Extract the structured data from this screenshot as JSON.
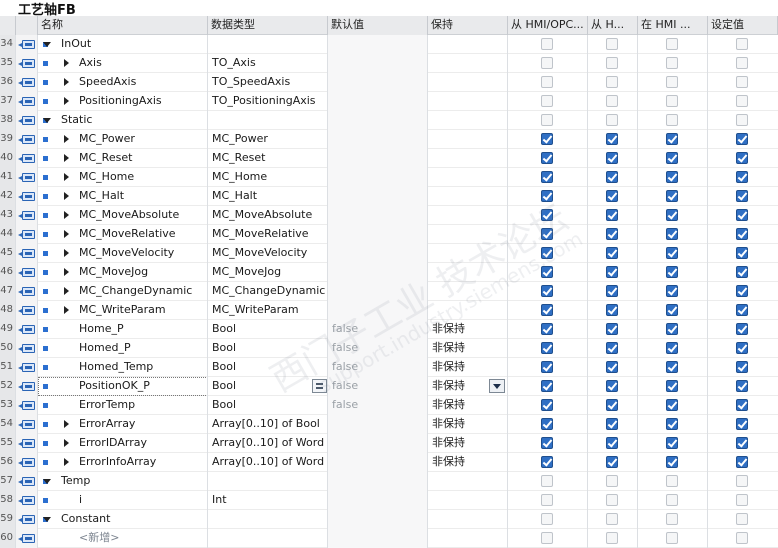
{
  "title": "工艺轴FB",
  "headers": {
    "name": "名称",
    "type": "数据类型",
    "default": "默认值",
    "retain": "保持",
    "hmi_opc": "从 HMI/OPC...",
    "hmi_h": "从 H...",
    "hmi_in": "在 HMI ...",
    "setpoint": "设定值"
  },
  "watermark": "西门子工业 技术论坛",
  "watermark_url": "support.industry.siemens.com",
  "rows": [
    {
      "num": "34",
      "kind": "section",
      "expand": "open",
      "name": "InOut",
      "type": "",
      "def": "",
      "ret": "",
      "c": [
        0,
        0,
        0,
        0
      ]
    },
    {
      "num": "35",
      "kind": "member",
      "expand": "closed",
      "name": "Axis",
      "type": "TO_Axis",
      "def": "",
      "ret": "",
      "c": [
        0,
        0,
        0,
        0
      ]
    },
    {
      "num": "36",
      "kind": "member",
      "expand": "closed",
      "name": "SpeedAxis",
      "type": "TO_SpeedAxis",
      "def": "",
      "ret": "",
      "c": [
        0,
        0,
        0,
        0
      ]
    },
    {
      "num": "37",
      "kind": "member",
      "expand": "closed",
      "name": "PositioningAxis",
      "type": "TO_PositioningAxis",
      "def": "",
      "ret": "",
      "c": [
        0,
        0,
        0,
        0
      ]
    },
    {
      "num": "38",
      "kind": "section",
      "expand": "open",
      "name": "Static",
      "type": "",
      "def": "",
      "ret": "",
      "c": [
        0,
        0,
        0,
        0
      ]
    },
    {
      "num": "39",
      "kind": "member",
      "expand": "closed",
      "name": "MC_Power",
      "type": "MC_Power",
      "def": "",
      "ret": "",
      "c": [
        1,
        1,
        1,
        1
      ]
    },
    {
      "num": "40",
      "kind": "member",
      "expand": "closed",
      "name": "MC_Reset",
      "type": "MC_Reset",
      "def": "",
      "ret": "",
      "c": [
        1,
        1,
        1,
        1
      ]
    },
    {
      "num": "41",
      "kind": "member",
      "expand": "closed",
      "name": "MC_Home",
      "type": "MC_Home",
      "def": "",
      "ret": "",
      "c": [
        1,
        1,
        1,
        1
      ]
    },
    {
      "num": "42",
      "kind": "member",
      "expand": "closed",
      "name": "MC_Halt",
      "type": "MC_Halt",
      "def": "",
      "ret": "",
      "c": [
        1,
        1,
        1,
        1
      ]
    },
    {
      "num": "43",
      "kind": "member",
      "expand": "closed",
      "name": "MC_MoveAbsolute",
      "type": "MC_MoveAbsolute",
      "def": "",
      "ret": "",
      "c": [
        1,
        1,
        1,
        1
      ]
    },
    {
      "num": "44",
      "kind": "member",
      "expand": "closed",
      "name": "MC_MoveRelative",
      "type": "MC_MoveRelative",
      "def": "",
      "ret": "",
      "c": [
        1,
        1,
        1,
        1
      ]
    },
    {
      "num": "45",
      "kind": "member",
      "expand": "closed",
      "name": "MC_MoveVelocity",
      "type": "MC_MoveVelocity",
      "def": "",
      "ret": "",
      "c": [
        1,
        1,
        1,
        1
      ]
    },
    {
      "num": "46",
      "kind": "member",
      "expand": "closed",
      "name": "MC_MoveJog",
      "type": "MC_MoveJog",
      "def": "",
      "ret": "",
      "c": [
        1,
        1,
        1,
        1
      ]
    },
    {
      "num": "47",
      "kind": "member",
      "expand": "closed",
      "name": "MC_ChangeDynamic",
      "type": "MC_ChangeDynamic",
      "def": "",
      "ret": "",
      "c": [
        1,
        1,
        1,
        1
      ]
    },
    {
      "num": "48",
      "kind": "member",
      "expand": "closed",
      "name": "MC_WriteParam",
      "type": "MC_WriteParam",
      "def": "",
      "ret": "",
      "c": [
        1,
        1,
        1,
        1
      ]
    },
    {
      "num": "49",
      "kind": "member",
      "expand": "none",
      "name": "Home_P",
      "type": "Bool",
      "def": "false",
      "ret": "非保持",
      "c": [
        1,
        1,
        1,
        1
      ]
    },
    {
      "num": "50",
      "kind": "member",
      "expand": "none",
      "name": "Homed_P",
      "type": "Bool",
      "def": "false",
      "ret": "非保持",
      "c": [
        1,
        1,
        1,
        1
      ]
    },
    {
      "num": "51",
      "kind": "member",
      "expand": "none",
      "name": "Homed_Temp",
      "type": "Bool",
      "def": "false",
      "ret": "非保持",
      "c": [
        1,
        1,
        1,
        1
      ]
    },
    {
      "num": "52",
      "kind": "member",
      "expand": "none",
      "name": "PositionOK_P",
      "type": "Bool",
      "def": "false",
      "ret": "非保持",
      "c": [
        1,
        1,
        1,
        1
      ],
      "selected": true
    },
    {
      "num": "53",
      "kind": "member",
      "expand": "none",
      "name": "ErrorTemp",
      "type": "Bool",
      "def": "false",
      "ret": "非保持",
      "c": [
        1,
        1,
        1,
        1
      ]
    },
    {
      "num": "54",
      "kind": "member",
      "expand": "closed",
      "name": "ErrorArray",
      "type": "Array[0..10] of Bool",
      "def": "",
      "ret": "非保持",
      "c": [
        1,
        1,
        1,
        1
      ]
    },
    {
      "num": "55",
      "kind": "member",
      "expand": "closed",
      "name": "ErrorIDArray",
      "type": "Array[0..10] of Word",
      "def": "",
      "ret": "非保持",
      "c": [
        1,
        1,
        1,
        1
      ]
    },
    {
      "num": "56",
      "kind": "member",
      "expand": "closed",
      "name": "ErrorInfoArray",
      "type": "Array[0..10] of Word",
      "def": "",
      "ret": "非保持",
      "c": [
        1,
        1,
        1,
        1
      ]
    },
    {
      "num": "57",
      "kind": "section",
      "expand": "open",
      "name": "Temp",
      "type": "",
      "def": "",
      "ret": "",
      "c": [
        0,
        0,
        0,
        0
      ]
    },
    {
      "num": "58",
      "kind": "member",
      "expand": "none",
      "name": "i",
      "type": "Int",
      "def": "",
      "ret": "",
      "c": [
        0,
        0,
        0,
        0
      ]
    },
    {
      "num": "59",
      "kind": "section",
      "expand": "open",
      "name": "Constant",
      "type": "",
      "def": "",
      "ret": "",
      "c": [
        0,
        0,
        0,
        0
      ]
    },
    {
      "num": "60",
      "kind": "add",
      "expand": "none",
      "name": "<新增>",
      "type": "",
      "def": "",
      "ret": "",
      "c": [
        0,
        0,
        0,
        0
      ]
    }
  ]
}
